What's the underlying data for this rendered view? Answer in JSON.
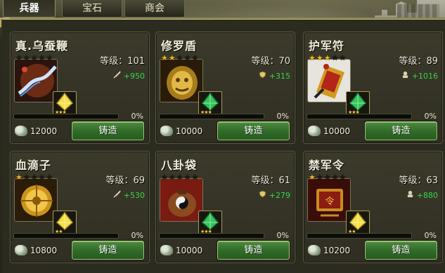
{
  "tabs": [
    {
      "label": "兵器",
      "active": true
    },
    {
      "label": "宝石",
      "active": false
    },
    {
      "label": "商会",
      "active": false
    }
  ],
  "colors": {
    "stat_green": "#37d64b",
    "star_gold": "#f2b024",
    "button_green": "#2f6a27"
  },
  "cards": [
    {
      "name": "真.乌蚕鞭",
      "stars": 0,
      "level_label": "等级：101",
      "attr_icon": "sword-icon",
      "attr_value": "+950",
      "progress_pct": 0,
      "progress_label": "0%",
      "cost": "12000",
      "button": "铸造",
      "gem_color": "gold",
      "gem_stars": "★★★"
    },
    {
      "name": "修罗盾",
      "stars": 2,
      "level_label": "等级：70",
      "attr_icon": "shield-icon",
      "attr_value": "+315",
      "progress_pct": 0,
      "progress_label": "0%",
      "cost": "10000",
      "button": "铸造",
      "gem_color": "green",
      "gem_stars": "★★★"
    },
    {
      "name": "护军符",
      "stars": 3,
      "level_label": "等级：89",
      "attr_icon": "soldier-icon",
      "attr_value": "+1016",
      "progress_pct": 0,
      "progress_label": "0%",
      "cost": "10000",
      "button": "铸造",
      "gem_color": "green",
      "gem_stars": "★★★"
    },
    {
      "name": "血滴子",
      "stars": 1,
      "level_label": "等级：69",
      "attr_icon": "sword-icon",
      "attr_value": "+530",
      "progress_pct": 0,
      "progress_label": "0%",
      "cost": "10800",
      "button": "铸造",
      "gem_color": "gold",
      "gem_stars": "★★"
    },
    {
      "name": "八卦袋",
      "stars": 0,
      "level_label": "等级：61",
      "attr_icon": "shield-icon",
      "attr_value": "+279",
      "progress_pct": 0,
      "progress_label": "0%",
      "cost": "10000",
      "button": "铸造",
      "gem_color": "green",
      "gem_stars": "★★★"
    },
    {
      "name": "禁军令",
      "stars": 1,
      "level_label": "等级：63",
      "attr_icon": "soldier-icon",
      "attr_value": "+880",
      "progress_pct": 0,
      "progress_label": "0%",
      "cost": "10200",
      "button": "铸造",
      "gem_color": "gold",
      "gem_stars": "★★"
    }
  ]
}
